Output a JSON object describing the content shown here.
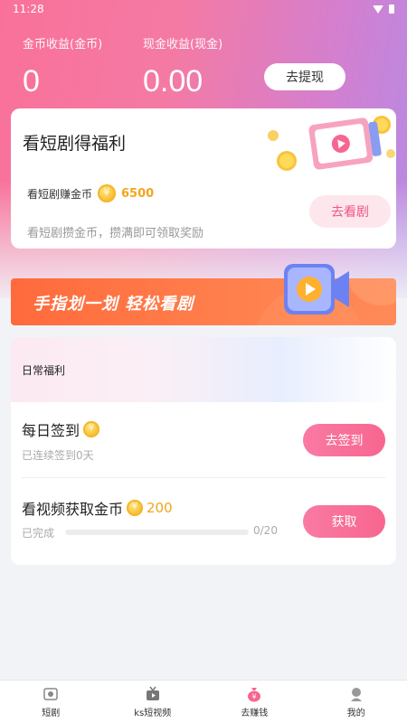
{
  "status_bar": {
    "time": "11:28"
  },
  "earnings": {
    "coin_label": "金币收益(金币)",
    "coin_value": "0",
    "cash_label": "现金收益(现金)",
    "cash_value": "0.00",
    "withdraw_button": "去提现"
  },
  "drama_card": {
    "title": "看短剧得福利",
    "reward_label": "看短剧赚金币",
    "reward_amount": "6500",
    "note": "看短剧攒金币，攒满即可领取奖励",
    "watch_button": "去看剧"
  },
  "banner": {
    "text": "手指划一划 轻松看剧"
  },
  "daily": {
    "title": "日常福利",
    "tasks": [
      {
        "title": "每日签到",
        "subtitle": "已连续签到0天",
        "button": "去签到"
      },
      {
        "title": "看视频获取金币",
        "reward": "200",
        "subtitle": "已完成",
        "progress_text": "0/20",
        "progress": 0,
        "button": "获取"
      }
    ]
  },
  "bottom_nav": [
    {
      "label": "短剧",
      "icon": "drama-icon"
    },
    {
      "label": "ks短视频",
      "icon": "tv-icon"
    },
    {
      "label": "去赚钱",
      "icon": "money-bag-icon"
    },
    {
      "label": "我的",
      "icon": "profile-icon"
    }
  ],
  "colors": {
    "accent": "#f7668f",
    "coin": "#f3a61c",
    "banner": "#ff6a3c"
  }
}
